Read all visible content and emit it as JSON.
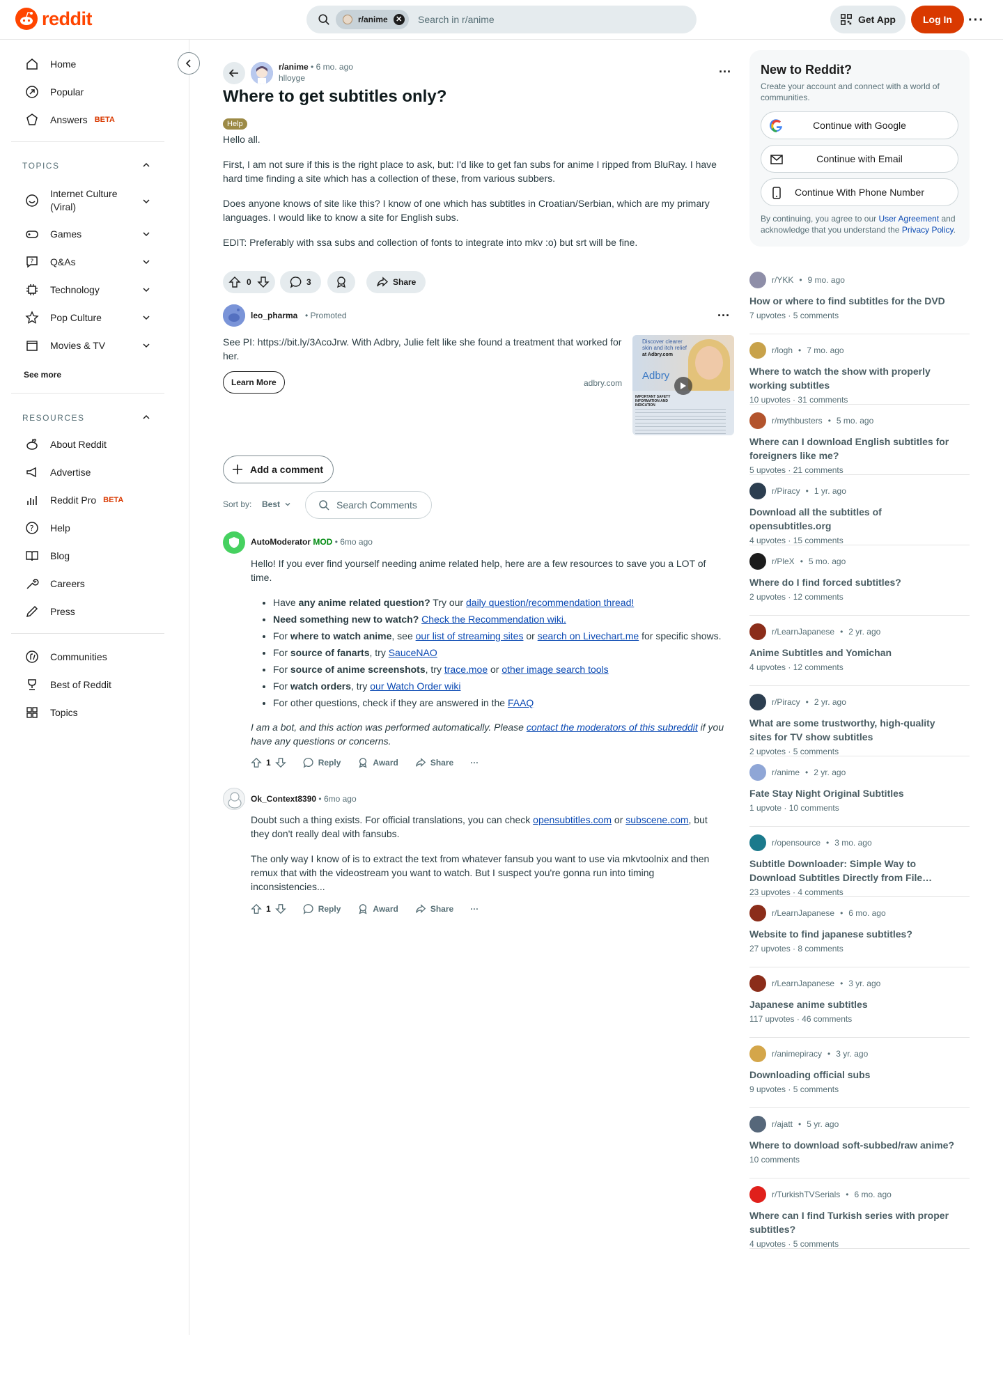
{
  "header": {
    "logo_text": "reddit",
    "search_chip": "r/anime",
    "search_placeholder": "Search in r/anime",
    "get_app": "Get App",
    "login": "Log In",
    "more": "···"
  },
  "sidebar": {
    "primary": [
      {
        "label": "Home",
        "icon": "home-icon"
      },
      {
        "label": "Popular",
        "icon": "popular-icon"
      },
      {
        "label": "Answers",
        "icon": "answers-icon",
        "badge": "BETA"
      }
    ],
    "topics_heading": "TOPICS",
    "topics": [
      {
        "label": "Internet Culture (Viral)",
        "icon": "smile-icon"
      },
      {
        "label": "Games",
        "icon": "gamepad-icon"
      },
      {
        "label": "Q&As",
        "icon": "question-bubble-icon"
      },
      {
        "label": "Technology",
        "icon": "chip-icon"
      },
      {
        "label": "Pop Culture",
        "icon": "star-icon"
      },
      {
        "label": "Movies & TV",
        "icon": "clapper-icon"
      }
    ],
    "see_more": "See more",
    "resources_heading": "RESOURCES",
    "resources": [
      {
        "label": "About Reddit",
        "icon": "reddit-alien-icon"
      },
      {
        "label": "Advertise",
        "icon": "megaphone-icon"
      },
      {
        "label": "Reddit Pro",
        "icon": "bar-chart-icon",
        "badge": "BETA"
      },
      {
        "label": "Help",
        "icon": "help-icon"
      },
      {
        "label": "Blog",
        "icon": "book-icon"
      },
      {
        "label": "Careers",
        "icon": "wrench-icon"
      },
      {
        "label": "Press",
        "icon": "pen-icon"
      }
    ],
    "more": [
      {
        "label": "Communities",
        "icon": "communities-icon"
      },
      {
        "label": "Best of Reddit",
        "icon": "trophy-icon"
      },
      {
        "label": "Topics",
        "icon": "grid-icon"
      }
    ]
  },
  "post": {
    "subreddit": "r/anime",
    "time": "6 mo. ago",
    "author": "hlloyge",
    "title": "Where to get subtitles only?",
    "flair": "Help",
    "paragraphs": [
      "Hello all.",
      "First, I am not sure if this is the right place to ask, but: I'd like to get fan subs for anime I ripped from BluRay. I have hard time finding a site which has a collection of these, from various subbers.",
      "Does anyone knows of site like this? I know of one which has subtitles in Croatian/Serbian, which are my primary languages. I would like to know a site for English subs.",
      "EDIT: Preferably with ssa subs and collection of fonts to integrate into mkv :o) but srt will be fine."
    ],
    "votes": "0",
    "comments": "3",
    "share": "Share"
  },
  "ad": {
    "advertiser": "leo_pharma",
    "promoted": "Promoted",
    "text": "See PI: https://bit.ly/3AcoJrw. With Adbry, Julie felt like she found a treatment that worked for her.",
    "cta": "Learn More",
    "domain": "adbry.com",
    "image_text_1": "Discover clearer skin and itch relief",
    "image_text_2": "at Adbry.com",
    "image_brand": "Adbry",
    "image_important": "IMPORTANT SAFETY INFORMATION AND INDICATION"
  },
  "comments_area": {
    "add_comment": "Add a comment",
    "sort_by": "Sort by:",
    "sort_value": "Best",
    "search_comments": "Search Comments"
  },
  "comments": [
    {
      "user": "AutoModerator",
      "mod": "MOD",
      "time": "6mo ago",
      "intro": "Hello! If you ever find yourself needing anime related help, here are a few resources to save you a LOT of time.",
      "list": [
        {
          "pre": "Have ",
          "bold": "any anime related question?",
          "mid": " Try our ",
          "link": "daily question/recommendation thread!",
          "post": ""
        },
        {
          "pre": "",
          "bold": "Need something new to watch?",
          "mid": " ",
          "link": "Check the Recommendation wiki.",
          "post": ""
        },
        {
          "pre": "For ",
          "bold": "where to watch anime",
          "mid": ", see ",
          "link": "our list of streaming sites",
          "mid2": " or ",
          "link2": "search on Livechart.me",
          "post": " for specific shows."
        },
        {
          "pre": "For ",
          "bold": "source of fanarts",
          "mid": ", try ",
          "link": "SauceNAO",
          "post": ""
        },
        {
          "pre": "For ",
          "bold": "source of anime screenshots",
          "mid": ", try ",
          "link": "trace.moe",
          "mid2": " or ",
          "link2": "other image search tools",
          "post": ""
        },
        {
          "pre": "For ",
          "bold": "watch orders",
          "mid": ", try ",
          "link": "our Watch Order wiki",
          "post": ""
        },
        {
          "pre": "For other questions, check if they are answered in the ",
          "bold": "",
          "mid": "",
          "link": "FAAQ",
          "post": ""
        }
      ],
      "bot_pre": "I am a bot, and this action was performed automatically. Please ",
      "bot_link": "contact the moderators of this subreddit",
      "bot_post": " if you have any questions or concerns.",
      "votes": "1"
    },
    {
      "user": "Ok_Context8390",
      "time": "6mo ago",
      "p1_pre": "Doubt such a thing exists. For official translations, you can check ",
      "p1_link1": "opensubtitles.com",
      "p1_mid": " or ",
      "p1_link2": "subscene.com",
      "p1_post": ", but they don't really deal with fansubs.",
      "p2": "The only way I know of is to extract the text from whatever fansub you want to use via mkvtoolnix and then remux that with the videostream you want to watch. But I suspect you're gonna run into timing inconsistencies...",
      "votes": "1"
    }
  ],
  "comment_actions": {
    "reply": "Reply",
    "award": "Award",
    "share": "Share",
    "more": "···"
  },
  "signup": {
    "title": "New to Reddit?",
    "subtitle": "Create your account and connect with a world of communities.",
    "google": "Continue with Google",
    "email": "Continue with Email",
    "phone": "Continue With Phone Number",
    "legal_pre": "By continuing, you agree to our ",
    "legal_link1": "User Agreement",
    "legal_mid": " and acknowledge that you understand the ",
    "legal_link2": "Privacy Policy",
    "legal_post": "."
  },
  "related": [
    {
      "sub": "r/YKK",
      "time": "9 mo. ago",
      "title": "How or where to find subtitles for the DVD",
      "upvotes": "7 upvotes",
      "comments": "5 comments",
      "color": "#8e8ea8"
    },
    {
      "sub": "r/logh",
      "time": "7 mo. ago",
      "title": "Where to watch the show with properly working subtitles",
      "upvotes": "10 upvotes",
      "comments": "31 comments",
      "color": "#c8a24a"
    },
    {
      "sub": "r/mythbusters",
      "time": "5 mo. ago",
      "title": "Where can I download English subtitles for foreigners like me?",
      "upvotes": "5 upvotes",
      "comments": "21 comments",
      "color": "#b3542d"
    },
    {
      "sub": "r/Piracy",
      "time": "1 yr. ago",
      "title": "Download all the subtitles of opensubtitles.org",
      "upvotes": "4 upvotes",
      "comments": "15 comments",
      "color": "#2c3e50"
    },
    {
      "sub": "r/PleX",
      "time": "5 mo. ago",
      "title": "Where do I find forced subtitles?",
      "upvotes": "2 upvotes",
      "comments": "12 comments",
      "color": "#1c1c1c"
    },
    {
      "sub": "r/LearnJapanese",
      "time": "2 yr. ago",
      "title": "Anime Subtitles and Yomichan",
      "upvotes": "4 upvotes",
      "comments": "12 comments",
      "color": "#8b2d1a"
    },
    {
      "sub": "r/Piracy",
      "time": "2 yr. ago",
      "title": "What are some trustworthy, high-quality sites for TV show subtitles",
      "upvotes": "2 upvotes",
      "comments": "5 comments",
      "color": "#2c3e50"
    },
    {
      "sub": "r/anime",
      "time": "2 yr. ago",
      "title": "Fate Stay Night Original Subtitles",
      "upvotes": "1 upvote",
      "comments": "10 comments",
      "color": "#8fa6d6"
    },
    {
      "sub": "r/opensource",
      "time": "3 mo. ago",
      "title": "Subtitle Downloader: Simple Way to Download Subtitles Directly from File…",
      "upvotes": "23 upvotes",
      "comments": "4 comments",
      "color": "#1b7a8c"
    },
    {
      "sub": "r/LearnJapanese",
      "time": "6 mo. ago",
      "title": "Website to find japanese subtitles?",
      "upvotes": "27 upvotes",
      "comments": "8 comments",
      "color": "#8b2d1a"
    },
    {
      "sub": "r/LearnJapanese",
      "time": "3 yr. ago",
      "title": "Japanese anime subtitles",
      "upvotes": "117 upvotes",
      "comments": "46 comments",
      "color": "#8b2d1a"
    },
    {
      "sub": "r/animepiracy",
      "time": "3 yr. ago",
      "title": "Downloading official subs",
      "upvotes": "9 upvotes",
      "comments": "5 comments",
      "color": "#d4a64a"
    },
    {
      "sub": "r/ajatt",
      "time": "5 yr. ago",
      "title": "Where to download soft-subbed/raw anime?",
      "upvotes": "",
      "comments": "10 comments",
      "color": "#56677a"
    },
    {
      "sub": "r/TurkishTVSerials",
      "time": "6 mo. ago",
      "title": "Where can I find Turkish series with proper subtitles?",
      "upvotes": "4 upvotes",
      "comments": "5 comments",
      "color": "#e0201b"
    }
  ],
  "colors": {
    "brand": "#ff4500",
    "login": "#d93900",
    "link": "#0a49b3",
    "mod": "#008a10",
    "flair": "#9c8a46"
  }
}
